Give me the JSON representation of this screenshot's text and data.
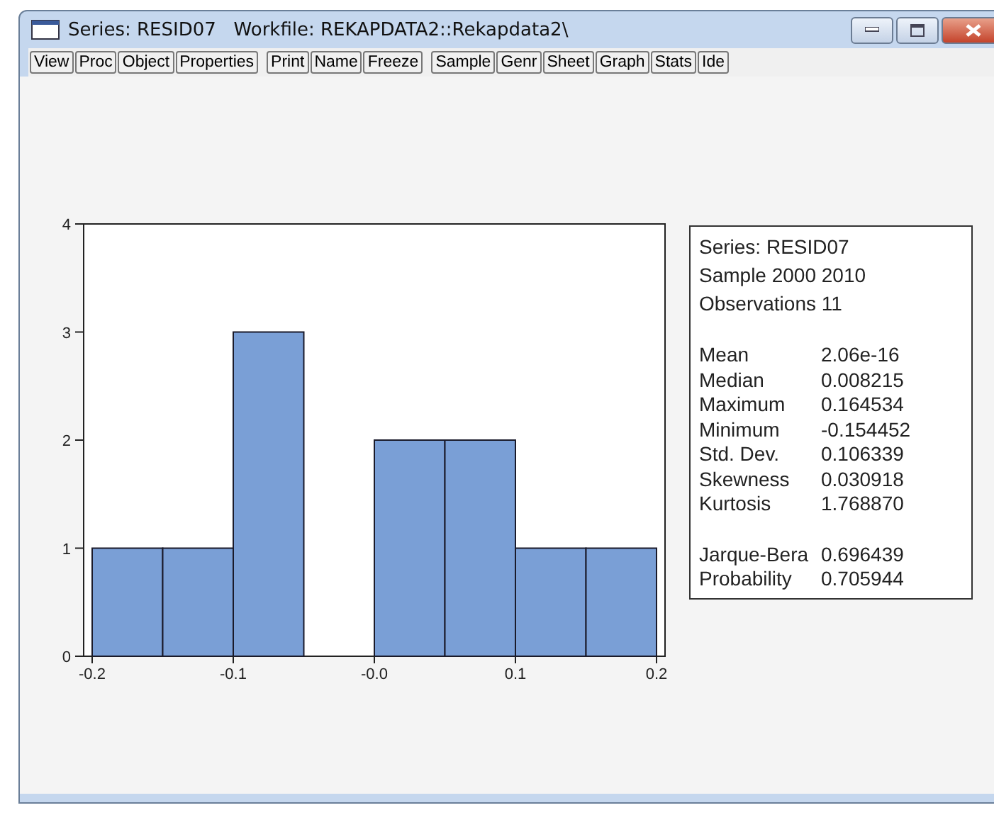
{
  "window": {
    "title": "Series: RESID07   Workfile: REKAPDATA2::Rekapdata2\\"
  },
  "toolbar": [
    [
      "View",
      "Proc",
      "Object",
      "Properties"
    ],
    [
      "Print",
      "Name",
      "Freeze"
    ],
    [
      "Sample",
      "Genr",
      "Sheet",
      "Graph",
      "Stats",
      "Ide"
    ]
  ],
  "histogram": {
    "chart_data": {
      "type": "bar",
      "x": [
        -0.175,
        -0.125,
        -0.075,
        -0.025,
        0.025,
        0.075,
        0.125,
        0.175
      ],
      "values": [
        1,
        1,
        3,
        0,
        2,
        2,
        1,
        1
      ],
      "xlim": [
        -0.2,
        0.2
      ],
      "ylim": [
        0,
        4
      ],
      "xticks": [
        -0.2,
        -0.1,
        {
          "value": 0,
          "label": "-0.0"
        },
        0.1,
        0.2
      ],
      "yticks": [
        0,
        1,
        2,
        3,
        4
      ]
    }
  },
  "stats": {
    "header": [
      "Series: RESID07",
      "Sample 2000 2010",
      "Observations 11"
    ],
    "rows": [
      {
        "label": "Mean",
        "value": "2.06e-16"
      },
      {
        "label": "Median",
        "value": "0.008215"
      },
      {
        "label": "Maximum",
        "value": "0.164534"
      },
      {
        "label": "Minimum",
        "value": "-0.154452"
      },
      {
        "label": "Std. Dev.",
        "value": "0.106339"
      },
      {
        "label": "Skewness",
        "value": "0.030918"
      },
      {
        "label": "Kurtosis",
        "value": "1.768870"
      }
    ],
    "tests": [
      {
        "label": "Jarque-Bera",
        "value": "0.696439"
      },
      {
        "label": "Probability",
        "value": "0.705944"
      }
    ]
  }
}
